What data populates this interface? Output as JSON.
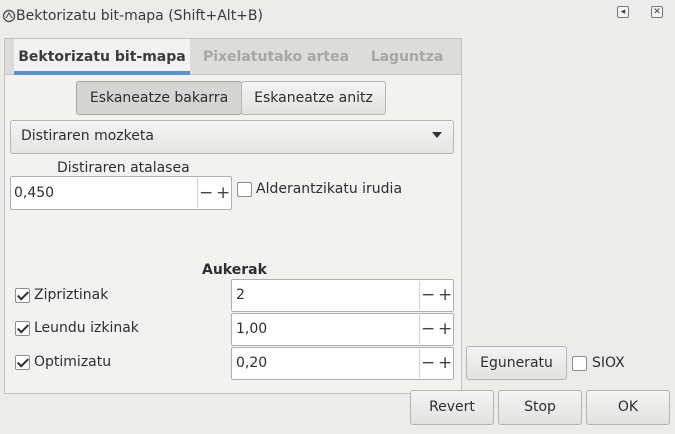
{
  "window": {
    "title": "Bektorizatu bit-mapa (Shift+Alt+B)",
    "icon": "app-icon",
    "controls": [
      "◂",
      "✕"
    ]
  },
  "tabs": [
    {
      "label": "Bektorizatu bit-mapa",
      "active": true
    },
    {
      "label": "Pixelatutako artea",
      "active": false
    },
    {
      "label": "Laguntza",
      "active": false
    }
  ],
  "scan_mode": {
    "single": "Eskaneatze bakarra",
    "multiple": "Eskaneatze anitz",
    "selected": "single"
  },
  "dropdown": {
    "value": "Distiraren mozketa"
  },
  "threshold": {
    "label": "Distiraren atalasea",
    "value": "0,450"
  },
  "invert": {
    "label": "Alderantzikatu irudia",
    "checked": false
  },
  "options": {
    "heading": "Aukerak",
    "speckles": {
      "label": "Zipriztinak",
      "checked": true,
      "value": "2"
    },
    "smooth_corners": {
      "label": "Leundu izkinak",
      "checked": true,
      "value": "1,00"
    },
    "optimize": {
      "label": "Optimizatu",
      "checked": true,
      "value": "0,20"
    }
  },
  "spin_buttons": {
    "minus": "−",
    "plus": "+"
  },
  "preview": {
    "update_label": "Eguneratu",
    "siox_label": "SIOX",
    "siox_checked": false
  },
  "footer": {
    "revert": "Revert",
    "stop": "Stop",
    "ok": "OK"
  }
}
